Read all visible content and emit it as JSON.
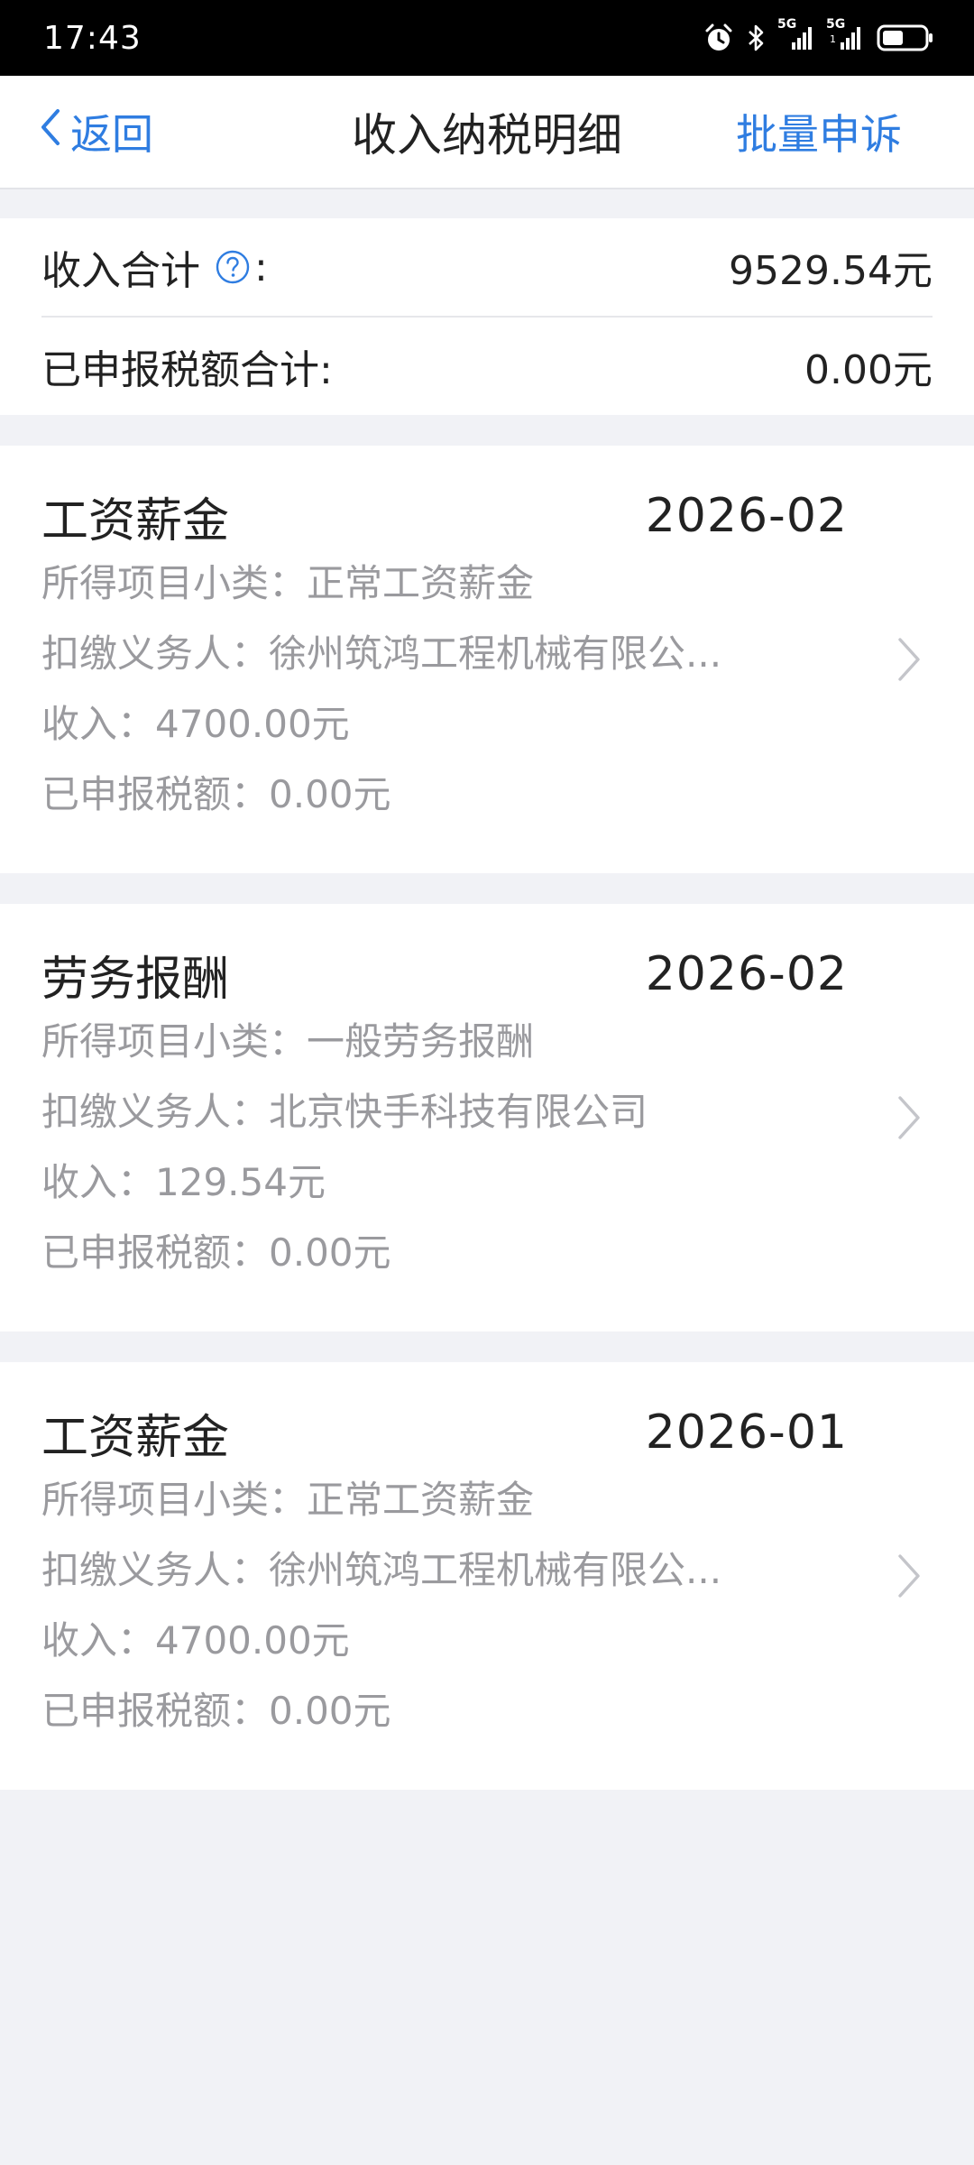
{
  "status_bar": {
    "time": "17:43",
    "network_label_1": "5G",
    "network_label_2": "5G",
    "network_sub_2": "1"
  },
  "nav": {
    "back_label": "返回",
    "title": "收入纳税明细",
    "action_label": "批量申诉"
  },
  "summary": {
    "income_label": "收入合计",
    "income_label_suffix": ":",
    "income_value": "9529.54元",
    "tax_label": "已申报税额合计:",
    "tax_value": "0.00元"
  },
  "records": [
    {
      "type": "工资薪金",
      "period": "2026-02",
      "subcategory": "所得项目小类：正常工资薪金",
      "withholder": "扣缴义务人：徐州筑鸿工程机械有限公...",
      "income": "收入：4700.00元",
      "tax": "已申报税额：0.00元"
    },
    {
      "type": "劳务报酬",
      "period": "2026-02",
      "subcategory": "所得项目小类：一般劳务报酬",
      "withholder": "扣缴义务人：北京快手科技有限公司",
      "income": "收入：129.54元",
      "tax": "已申报税额：0.00元"
    },
    {
      "type": "工资薪金",
      "period": "2026-01",
      "subcategory": "所得项目小类：正常工资薪金",
      "withholder": "扣缴义务人：徐州筑鸿工程机械有限公...",
      "income": "收入：4700.00元",
      "tax": "已申报税额：0.00元"
    }
  ],
  "icons": {
    "back": "chevron-left-icon",
    "help": "question-circle-icon",
    "row_arrow": "chevron-right-icon",
    "alarm": "alarm-icon",
    "bluetooth": "bluetooth-icon",
    "signal": "signal-icon",
    "battery": "battery-icon"
  },
  "colors": {
    "accent": "#2f7de1",
    "page_background": "#f1f2f6",
    "secondary_text": "#9a9a9e",
    "primary_text": "#222222"
  }
}
